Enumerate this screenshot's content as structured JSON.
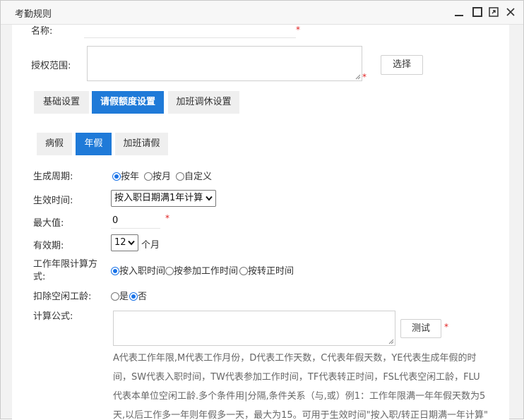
{
  "window": {
    "title": "考勤规则",
    "controls": {
      "minimize": "minimize-icon",
      "maximize": "maximize-icon",
      "restore": "restore-icon",
      "close": "close-icon"
    }
  },
  "form": {
    "name_label": "名称:",
    "name_required": "*",
    "scope_label": "授权范围:",
    "scope_required": "*",
    "select_button": "选择"
  },
  "tabs": [
    {
      "label": "基础设置",
      "active": false
    },
    {
      "label": "请假额度设置",
      "active": true
    },
    {
      "label": "加班调休设置",
      "active": false
    }
  ],
  "subtabs": [
    {
      "label": "病假",
      "active": false
    },
    {
      "label": "年假",
      "active": true
    },
    {
      "label": "加班请假",
      "active": false
    }
  ],
  "leave": {
    "cycle_label": "生成周期:",
    "cycle_options": [
      {
        "label": "按年",
        "checked": true
      },
      {
        "label": "按月",
        "checked": false
      },
      {
        "label": "自定义",
        "checked": false
      }
    ],
    "effective_label": "生效时间:",
    "effective_value": "按入职日期满1年计算",
    "max_label": "最大值:",
    "max_value": "0",
    "max_required": "*",
    "validity_label": "有效期:",
    "validity_value": "12",
    "validity_unit": "个月",
    "seniority_label_line1": "工作年限计算方",
    "seniority_label_line2": "式:",
    "seniority_options": [
      {
        "label": "按入职时间",
        "checked": true
      },
      {
        "label": "按参加工作时间",
        "checked": false
      },
      {
        "label": "按转正时间",
        "checked": false
      }
    ],
    "deduct_label": "扣除空闲工龄:",
    "deduct_options": [
      {
        "label": "是",
        "checked": false
      },
      {
        "label": "否",
        "checked": true
      }
    ],
    "formula_label": "计算公式:",
    "test_button": "测试",
    "formula_required": "*",
    "formula_note_lines": [
      "A代表工作年限,M代表工作月份，D代表工作天数，C代表年假天数，YE代表生成年假的时",
      "间，SW代表入职时间，TW代表参加工作时间，TF代表转正时间，FSL代表空闲工龄，FLU",
      "代表本单位空闲工龄.多个条件用|分隔,条件关系（与,或）例1：工作年限满一年年假天数为5",
      "天,以后工作多一年则年假多一天，最大为15。可用于生效时间\"按入职/转正日期满一年计算\""
    ]
  }
}
